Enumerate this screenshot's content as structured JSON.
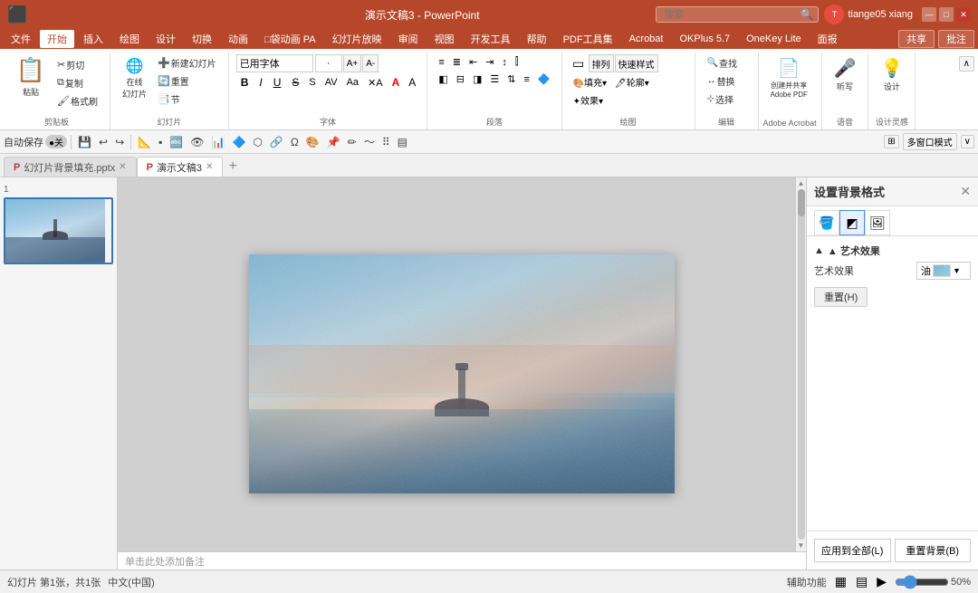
{
  "titleBar": {
    "title": "演示文稿3 - PowerPoint",
    "searchPlaceholder": "搜索",
    "userName": "tiange05 xiang",
    "windowControls": {
      "minimize": "—",
      "maximize": "□",
      "close": "✕"
    }
  },
  "menuBar": {
    "items": [
      "文件",
      "开始",
      "插入",
      "绘图",
      "设计",
      "切换",
      "动画",
      "幻灯片放映",
      "审阅",
      "视图",
      "开发工具",
      "帮助",
      "PDF工具集",
      "Acrobat",
      "OKPlus 5.7",
      "OneKey Lite",
      "面报"
    ],
    "activeItem": "开始",
    "shareLabel": "共享",
    "commentLabel": "批注"
  },
  "ribbon": {
    "groups": [
      {
        "name": "clipboard",
        "label": "剪贴板",
        "buttons": [
          {
            "id": "paste",
            "label": "粘贴",
            "icon": "📋",
            "size": "large"
          },
          {
            "id": "cut",
            "label": "剪切",
            "icon": "✂"
          },
          {
            "id": "copy",
            "label": "复制",
            "icon": "⧉"
          },
          {
            "id": "format-painter",
            "label": "格式刷",
            "icon": "🖌"
          }
        ]
      },
      {
        "name": "slides",
        "label": "幻灯片",
        "buttons": [
          {
            "id": "new-slide-online",
            "label": "在线幻灯片"
          },
          {
            "id": "new-slide",
            "label": "新建幻灯片"
          },
          {
            "id": "reset",
            "label": "重置"
          },
          {
            "id": "section",
            "label": "节"
          }
        ]
      },
      {
        "name": "font",
        "label": "字体",
        "fontName": "已用字体",
        "fontSize": "·",
        "buttons": [
          {
            "id": "bold",
            "label": "B"
          },
          {
            "id": "italic",
            "label": "I"
          },
          {
            "id": "underline",
            "label": "U"
          },
          {
            "id": "strikethrough",
            "label": "S"
          },
          {
            "id": "font-color",
            "label": "A"
          },
          {
            "id": "highlight",
            "label": "A"
          }
        ]
      },
      {
        "name": "paragraph",
        "label": "段落",
        "buttons": []
      },
      {
        "name": "drawing",
        "label": "绘图",
        "buttons": []
      },
      {
        "name": "editing",
        "label": "编辑",
        "buttons": [
          {
            "id": "find",
            "label": "查找"
          },
          {
            "id": "replace",
            "label": "替换"
          },
          {
            "id": "select",
            "label": "选择"
          }
        ]
      },
      {
        "name": "adobe-acrobat",
        "label": "Adobe Acrobat",
        "buttons": [
          {
            "id": "create-share",
            "label": "创建并共享Adobe PDF"
          }
        ]
      },
      {
        "name": "voice",
        "label": "语音",
        "buttons": [
          {
            "id": "dictate",
            "label": "听写"
          }
        ]
      },
      {
        "name": "design-sense",
        "label": "设计灵感",
        "buttons": [
          {
            "id": "design",
            "label": "设计"
          }
        ]
      }
    ]
  },
  "toolbar": {
    "items": [
      "自动保存 ●关",
      "💾",
      "↩",
      "↪",
      "📐",
      "▪",
      "🔤",
      "👁",
      "📊",
      "🔷",
      "⬡",
      "🔗",
      "Ω",
      "🎨",
      "📌",
      "✏",
      "〜",
      "⠿",
      "▤"
    ],
    "multiWindowLabel": "多窗口模式"
  },
  "tabs": [
    {
      "id": "file1",
      "label": "幻灯片背景填充.pptx",
      "icon": "P",
      "active": false,
      "closable": true
    },
    {
      "id": "file2",
      "label": "演示文稿3",
      "icon": "P",
      "active": true,
      "closable": true
    }
  ],
  "slidePanel": {
    "slideNumber": "1",
    "totalSlides": "1"
  },
  "canvasArea": {
    "notesPlaceholder": "单击此处添加备注"
  },
  "rightPanel": {
    "title": "设置背景格式",
    "tabs": [
      {
        "id": "fill",
        "icon": "🪣",
        "active": false
      },
      {
        "id": "effect",
        "icon": "◩",
        "active": true
      },
      {
        "id": "image",
        "icon": "🖼",
        "active": false
      }
    ],
    "artEffectSection": {
      "title": "▲ 艺术效果",
      "labelText": "艺术效果",
      "dropdownValue": "油",
      "resetLabel": "重置(H)"
    },
    "bottomButtons": {
      "applyAll": "应用到全部(L)",
      "resetBg": "重置背景(B)"
    }
  },
  "statusBar": {
    "slideInfo": "幻灯片 第1张，共1张",
    "language": "中文(中国)",
    "accessibility": "辅助功能",
    "viewNormal": "▦",
    "viewSlide": "▤",
    "viewSlideshow": "▶",
    "zoom": "50%"
  }
}
